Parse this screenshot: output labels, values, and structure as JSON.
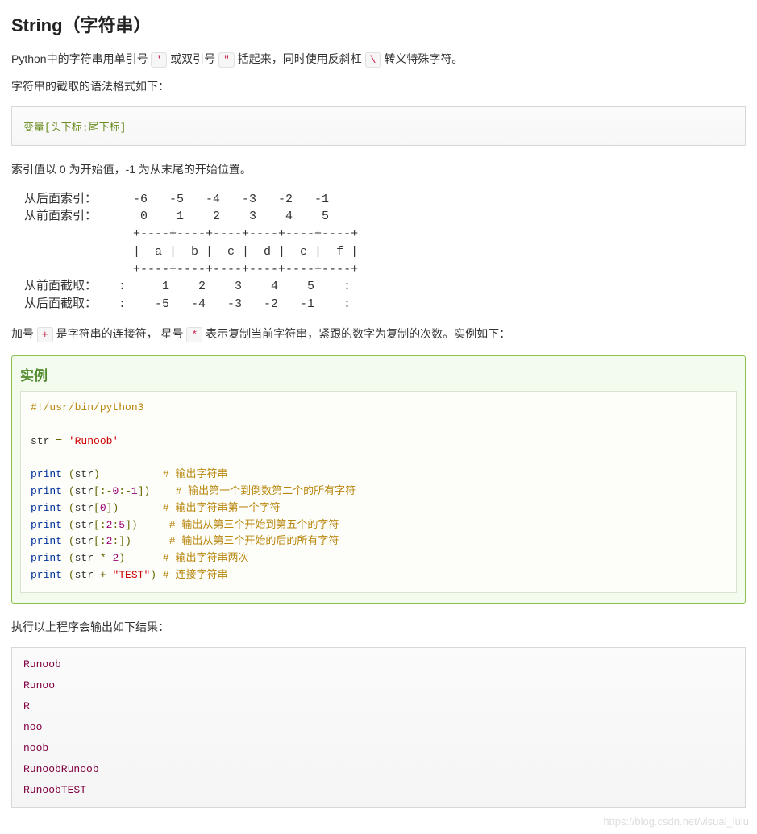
{
  "heading": "String（字符串）",
  "intro1_parts": {
    "p1": "Python中的字符串用单引号 ",
    "c1": "'",
    "p2": " 或双引号 ",
    "c2": "\"",
    "p3": " 括起来，同时使用反斜杠 ",
    "c3": "\\",
    "p4": " 转义特殊字符。"
  },
  "intro2": "字符串的截取的语法格式如下：",
  "syntax_line": "变量[头下标:尾下标]",
  "index_note": "索引值以 0 为开始值，-1 为从末尾的开始位置。",
  "ascii_diagram": "从后面索引：     -6   -5   -4   -3   -2   -1\n从前面索引：      0    1    2    3    4    5\n               +----+----+----+----+----+----+\n               |  a |  b |  c |  d |  e |  f |\n               +----+----+----+----+----+----+\n从前面截取：   :     1    2    3    4    5    :\n从后面截取：   :    -5   -4   -3   -2   -1    :",
  "para_operators": {
    "p1": "加号 ",
    "c1": "+",
    "p2": " 是字符串的连接符， 星号 ",
    "c2": "*",
    "p3": " 表示复制当前字符串，紧跟的数字为复制的次数。实例如下："
  },
  "example_title": "实例",
  "code_example": {
    "shebang": "#!/usr/bin/python3",
    "assign_var": "str",
    "assign_eq": " = ",
    "assign_str": "'Runoob'",
    "lines": [
      {
        "call": "print",
        "open": " (",
        "arg": "str",
        "close": ")",
        "pad": "          ",
        "cmt": "# 输出字符串"
      },
      {
        "call": "print",
        "open": " (",
        "arg": "str",
        "idx": "[0:-1]",
        "close": ")",
        "pad": "    ",
        "cmt": "# 输出第一个到倒数第二个的所有字符"
      },
      {
        "call": "print",
        "open": " (",
        "arg": "str",
        "idx": "[0]",
        "close": ")",
        "pad": "       ",
        "cmt": "# 输出字符串第一个字符"
      },
      {
        "call": "print",
        "open": " (",
        "arg": "str",
        "idx": "[2:5]",
        "close": ")",
        "pad": "     ",
        "cmt": "# 输出从第三个开始到第五个的字符"
      },
      {
        "call": "print",
        "open": " (",
        "arg": "str",
        "idx": "[2:]",
        "close": ")",
        "pad": "      ",
        "cmt": "# 输出从第三个开始的后的所有字符"
      },
      {
        "call": "print",
        "open": " (",
        "arg": "str",
        "op": " * ",
        "rhs_num": "2",
        "close": ")",
        "pad": "      ",
        "cmt": "# 输出字符串两次"
      },
      {
        "call": "print",
        "open": " (",
        "arg": "str",
        "op": " + ",
        "rhs_str": "\"TEST\"",
        "close": ")",
        "pad": " ",
        "cmt": "# 连接字符串"
      }
    ]
  },
  "output_intro": "执行以上程序会输出如下结果：",
  "output_lines": "Runoob\nRunoo\nR\nnoo\nnoob\nRunoobRunoob\nRunoobTEST",
  "watermark": "https://blog.csdn.net/visual_lulu"
}
